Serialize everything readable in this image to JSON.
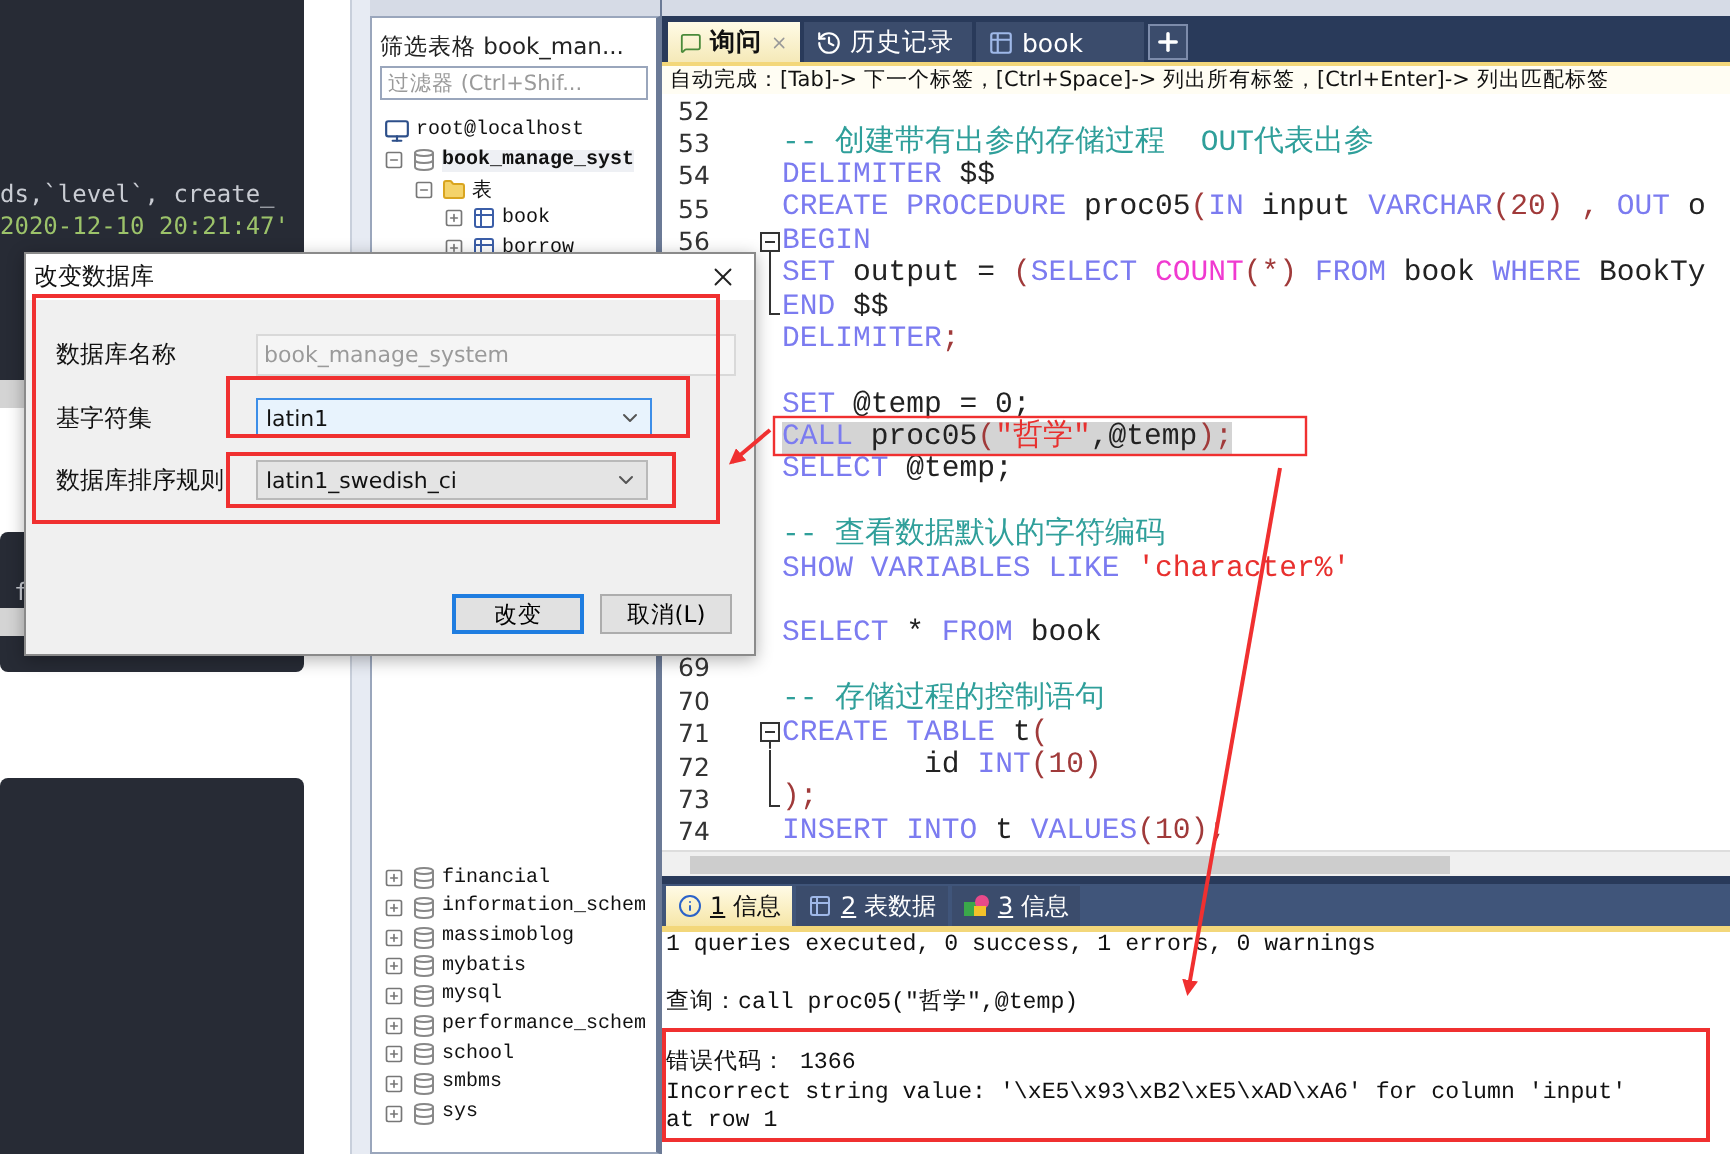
{
  "background_editor": {
    "lines": [
      {
        "text": "ds,`level`, create_",
        "kind": "plain"
      },
      {
        "text": "2020-12-10 20:21:47'",
        "kind": "string"
      }
    ],
    "lower_text": "f"
  },
  "object_browser": {
    "title": "筛选表格 book_man...",
    "filter": {
      "placeholder": "过滤器 (Ctrl+Shif..."
    },
    "tree": [
      {
        "label": "root@localhost",
        "kind": "server",
        "children": [
          {
            "label": "book_manage_syst",
            "kind": "database",
            "expanded": true,
            "selected": true,
            "children": [
              {
                "label": "表",
                "kind": "folder",
                "expanded": true,
                "children": [
                  {
                    "label": "book",
                    "kind": "table",
                    "expanded": false,
                    "selected": false
                  },
                  {
                    "label": "borrow",
                    "kind": "table",
                    "expanded": false,
                    "selected": false
                  }
                ]
              }
            ]
          },
          {
            "label": "financial",
            "kind": "database",
            "expanded": false,
            "selected": false
          },
          {
            "label": "information_schem",
            "kind": "database",
            "expanded": false,
            "selected": false
          },
          {
            "label": "massimoblog",
            "kind": "database",
            "expanded": false,
            "selected": false
          },
          {
            "label": "mybatis",
            "kind": "database",
            "expanded": false,
            "selected": false
          },
          {
            "label": "mysql",
            "kind": "database",
            "expanded": false,
            "selected": false
          },
          {
            "label": "performance_schem",
            "kind": "database",
            "expanded": false,
            "selected": false
          },
          {
            "label": "school",
            "kind": "database",
            "expanded": false,
            "selected": false
          },
          {
            "label": "smbms",
            "kind": "database",
            "expanded": false,
            "selected": false
          },
          {
            "label": "sys",
            "kind": "database",
            "expanded": false,
            "selected": false
          }
        ]
      }
    ]
  },
  "editor": {
    "tabs": [
      {
        "label": "询问",
        "kind": "query",
        "selected": true
      },
      {
        "label": "历史记录",
        "kind": "history",
        "selected": false
      },
      {
        "label": "book",
        "kind": "table",
        "selected": false
      }
    ],
    "hint": "自动完成：[Tab]-> 下一个标签，[Ctrl+Space]-> 列出所有标签，[Ctrl+Enter]-> 列出匹配标签",
    "lines": [
      {
        "kind": "blank",
        "number": "52"
      },
      {
        "kind": "code",
        "number": "53",
        "tokens": [
          {
            "text": "-- 创建带有出参的存储过程  OUT代表出参",
            "kind": "comment"
          }
        ]
      },
      {
        "kind": "code",
        "number": "54",
        "tokens": [
          {
            "text": "DELIMITER",
            "kind": "keyword"
          },
          {
            "text": " $$",
            "kind": "ident"
          }
        ]
      },
      {
        "kind": "code",
        "number": "55",
        "tokens": [
          {
            "text": "CREATE PROCEDURE",
            "kind": "keyword"
          },
          {
            "text": " proc05",
            "kind": "ident"
          },
          {
            "text": "(",
            "kind": "punct"
          },
          {
            "text": "IN",
            "kind": "keyword"
          },
          {
            "text": " input ",
            "kind": "ident"
          },
          {
            "text": "VARCHAR",
            "kind": "keyword"
          },
          {
            "text": "(20)",
            "kind": "punct"
          },
          {
            "text": " , ",
            "kind": "punct"
          },
          {
            "text": "OUT",
            "kind": "keyword"
          },
          {
            "text": " o",
            "kind": "ident"
          }
        ]
      },
      {
        "kind": "code",
        "number": "56",
        "fold": {
          "kind": "start"
        },
        "tokens": [
          {
            "text": "BEGIN",
            "kind": "keyword"
          }
        ]
      },
      {
        "kind": "code",
        "fold": {
          "kind": "mid"
        },
        "tokens": [
          {
            "text": "SET",
            "kind": "keyword"
          },
          {
            "text": " output = ",
            "kind": "ident"
          },
          {
            "text": "(",
            "kind": "punct"
          },
          {
            "text": "SELECT ",
            "kind": "keyword"
          },
          {
            "text": "COUNT",
            "kind": "function"
          },
          {
            "text": "(*) ",
            "kind": "punct"
          },
          {
            "text": "FROM",
            "kind": "keyword"
          },
          {
            "text": " book ",
            "kind": "ident"
          },
          {
            "text": "WHERE",
            "kind": "keyword"
          },
          {
            "text": " BookTy",
            "kind": "ident"
          }
        ]
      },
      {
        "kind": "code",
        "fold": {
          "kind": "end"
        },
        "tokens": [
          {
            "text": "END",
            "kind": "keyword"
          },
          {
            "text": " $$",
            "kind": "ident"
          }
        ]
      },
      {
        "kind": "code",
        "tokens": [
          {
            "text": "DELIMITER",
            "kind": "keyword"
          },
          {
            "text": ";",
            "kind": "punct"
          }
        ]
      },
      {
        "kind": "blank"
      },
      {
        "kind": "code",
        "tokens": [
          {
            "text": "SET",
            "kind": "keyword"
          },
          {
            "text": " @temp = 0;",
            "kind": "ident"
          }
        ]
      },
      {
        "kind": "code",
        "highlighted": true,
        "tokens": [
          {
            "text": "CALL",
            "kind": "keyword"
          },
          {
            "text": " proc05",
            "kind": "ident"
          },
          {
            "text": "(",
            "kind": "punct"
          },
          {
            "text": "\"哲学\"",
            "kind": "string"
          },
          {
            "text": ",@temp",
            "kind": "ident"
          },
          {
            "text": ");",
            "kind": "punct"
          }
        ]
      },
      {
        "kind": "code",
        "tokens": [
          {
            "text": "SELECT",
            "kind": "keyword"
          },
          {
            "text": " @temp;",
            "kind": "ident"
          }
        ]
      },
      {
        "kind": "blank"
      },
      {
        "kind": "code",
        "tokens": [
          {
            "text": "-- 查看数据默认的字符编码",
            "kind": "comment"
          }
        ]
      },
      {
        "kind": "code",
        "tokens": [
          {
            "text": "SHOW VARIABLES LIKE ",
            "kind": "keyword"
          },
          {
            "text": "'character%'",
            "kind": "string"
          }
        ]
      },
      {
        "kind": "blank"
      },
      {
        "kind": "code",
        "tokens": [
          {
            "text": "SELECT",
            "kind": "keyword"
          },
          {
            "text": " * ",
            "kind": "ident"
          },
          {
            "text": "FROM",
            "kind": "keyword"
          },
          {
            "text": " book",
            "kind": "ident"
          }
        ]
      },
      {
        "kind": "blank",
        "number": "69"
      },
      {
        "kind": "code",
        "number": "70",
        "tokens": [
          {
            "text": "-- 存储过程的控制语句",
            "kind": "comment"
          }
        ]
      },
      {
        "kind": "code",
        "number": "71",
        "fold": {
          "kind": "start"
        },
        "tokens": [
          {
            "text": "CREATE TABLE",
            "kind": "keyword"
          },
          {
            "text": " t",
            "kind": "ident"
          },
          {
            "text": "(",
            "kind": "punct"
          }
        ]
      },
      {
        "kind": "code",
        "number": "72",
        "fold": {
          "kind": "mid"
        },
        "tokens": [
          {
            "text": "        id ",
            "kind": "ident"
          },
          {
            "text": "INT",
            "kind": "keyword"
          },
          {
            "text": "(10)",
            "kind": "punct"
          }
        ]
      },
      {
        "kind": "code",
        "number": "73",
        "fold": {
          "kind": "end"
        },
        "tokens": [
          {
            "text": ");",
            "kind": "punct"
          }
        ]
      },
      {
        "kind": "code",
        "number": "74",
        "tokens": [
          {
            "text": "INSERT INTO",
            "kind": "keyword"
          },
          {
            "text": " t ",
            "kind": "ident"
          },
          {
            "text": "VALUES",
            "kind": "keyword"
          },
          {
            "text": "(10);",
            "kind": "punct"
          }
        ]
      }
    ]
  },
  "result_panel": {
    "tabs": [
      {
        "number": "1",
        "label": "信息",
        "kind": "info",
        "selected": true
      },
      {
        "number": "2",
        "label": "表数据",
        "kind": "data",
        "selected": false
      },
      {
        "number": "3",
        "label": "信息",
        "kind": "profile",
        "selected": false
      }
    ],
    "messages": [
      {
        "kind": "summary",
        "text": "1 queries executed, 0 success, 1 errors, 0 warnings"
      },
      {
        "kind": "query",
        "text": "查询：call proc05(\"哲学\",@temp)"
      },
      {
        "kind": "error",
        "text": "错误代码： 1366"
      },
      {
        "kind": "error",
        "text": "Incorrect string value: '\\xE5\\x93\\xB2\\xE5\\xAD\\xA6' for column 'input'"
      },
      {
        "kind": "error",
        "text": "at row 1"
      }
    ]
  },
  "dialog": {
    "title": "改变数据库",
    "fields": [
      {
        "label": "数据库名称",
        "kind": "text",
        "value": "book_manage_system",
        "disabled": true,
        "focused": false
      },
      {
        "label": "基字符集",
        "kind": "dropdown",
        "value": "latin1",
        "focused": true
      },
      {
        "label": "数据库排序规则",
        "kind": "dropdown",
        "value": "latin1_swedish_ci",
        "focused": false
      }
    ],
    "buttons": [
      {
        "label": "改变",
        "default": true
      },
      {
        "label": "取消(L)",
        "default": false
      }
    ]
  }
}
